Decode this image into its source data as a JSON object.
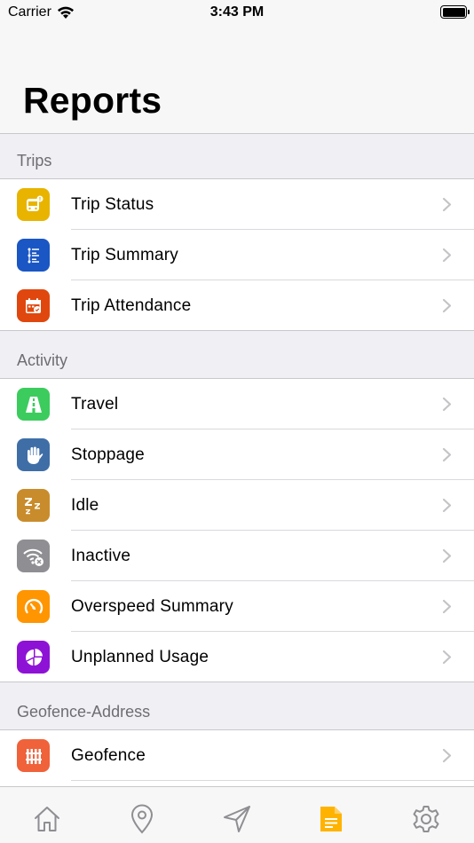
{
  "status_bar": {
    "carrier": "Carrier",
    "time": "3:43 PM"
  },
  "header": {
    "title": "Reports"
  },
  "sections": [
    {
      "title": "Trips",
      "items": [
        {
          "label": "Trip Status",
          "icon": "bus-alert-icon",
          "color": "#e8b400"
        },
        {
          "label": "Trip Summary",
          "icon": "list-icon",
          "color": "#1a56c4"
        },
        {
          "label": "Trip Attendance",
          "icon": "calendar-check-icon",
          "color": "#e0470e"
        }
      ]
    },
    {
      "title": "Activity",
      "items": [
        {
          "label": "Travel",
          "icon": "road-icon",
          "color": "#3ccc5e"
        },
        {
          "label": "Stoppage",
          "icon": "hand-icon",
          "color": "#3f6ea7"
        },
        {
          "label": "Idle",
          "icon": "sleep-icon",
          "color": "#c98c2c"
        },
        {
          "label": "Inactive",
          "icon": "signal-off-icon",
          "color": "#8e8e93"
        },
        {
          "label": "Overspeed Summary",
          "icon": "speedometer-icon",
          "color": "#ff9500"
        },
        {
          "label": "Unplanned Usage",
          "icon": "pie-chart-icon",
          "color": "#8e12d6"
        }
      ]
    },
    {
      "title": "Geofence-Address",
      "items": [
        {
          "label": "Geofence",
          "icon": "fence-icon",
          "color": "#f0623a"
        },
        {
          "label": "",
          "icon": "geofence-next-icon",
          "color": "#4f6fd9"
        }
      ]
    }
  ],
  "tab_bar": {
    "active_color": "#ffb300",
    "inactive_color": "#8e8e93",
    "tabs": [
      "home-icon",
      "location-pin-icon",
      "navigation-icon",
      "reports-icon",
      "settings-icon"
    ],
    "active_index": 3
  }
}
